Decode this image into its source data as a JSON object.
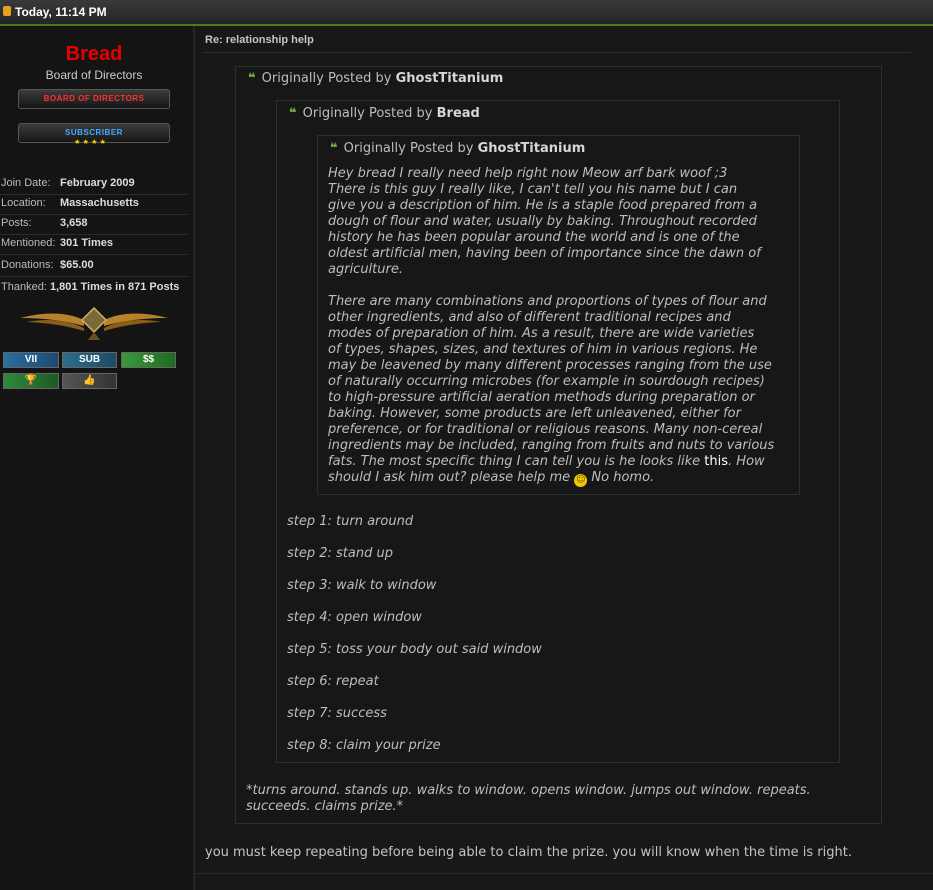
{
  "topbar": {
    "date": "Today, 11:14 PM"
  },
  "user": {
    "name": "Bread",
    "title": "Board of Directors",
    "rank_images": [
      "BOARD OF DIRECTORS",
      "SUBSCRIBER"
    ],
    "info": [
      {
        "label": "Join Date:",
        "value": "February 2009"
      },
      {
        "label": "Location:",
        "value": "Massachusetts"
      },
      {
        "label": "Posts:",
        "value": "3,658"
      },
      {
        "label": "Mentioned:",
        "value": "301 Times"
      },
      {
        "label": "Donations:",
        "value": "$65.00"
      }
    ],
    "thanked_label": "Thanked:",
    "thanked_value": "1,801 Times in 871 Posts",
    "awards": [
      "VII",
      "SUB",
      "$$",
      "🏆",
      "👍"
    ]
  },
  "post": {
    "title": "Re: relationship help",
    "quote1": {
      "prefix": "Originally Posted by",
      "author": "GhostTitanium"
    },
    "quote2": {
      "prefix": "Originally Posted by",
      "author": "Bread"
    },
    "quote3": {
      "prefix": "Originally Posted by",
      "author": "GhostTitanium",
      "para1": "Hey bread I really need help right now Meow arf bark woof ;3\nThere is this guy I really like, I can't tell you his name but I can\ngive you a description of him. He is a staple food prepared from a\ndough of flour and water, usually by baking. Throughout recorded\nhistory he has been popular around the world and is one of the\noldest artificial men, having been of importance since the dawn of\nagriculture.",
      "para2": "There are many combinations and proportions of types of flour and\nother ingredients, and also of different traditional recipes and\nmodes of preparation of him. As a result, there are wide varieties\nof types, shapes, sizes, and textures of him in various regions. He\nmay be leavened by many different processes ranging from the use\nof naturally occurring microbes (for example in sourdough recipes)\nto high-pressure artificial aeration methods during preparation or\nbaking. However, some products are left unleavened, either for\npreference, or for traditional or religious reasons. Many non-cereal\ningredients may be included, ranging from fruits and nuts to various\nfats. The most specific thing I can tell you is he looks like ",
      "link": "this",
      "para2_end": ". How",
      "line_last": "should I ask him out? please help me ",
      "smiley": "☺",
      "line_tail": " No homo."
    },
    "steps": [
      "step 1: turn around",
      "step 2: stand up",
      "step 3: walk to window",
      "step 4: open window",
      "step 5: toss your body out said window",
      "step 6: repeat",
      "step 7: success",
      "step 8: claim your prize"
    ],
    "quote1_text": "*turns around. stands up. walks to window. opens window. jumps out window. repeats.\nsucceeds. claims prize.*",
    "reply": "you must keep repeating before being able to claim the prize. you will know when the time is right."
  },
  "colors": {
    "username": "#e60000",
    "accent": "#4a7a1e",
    "quote_icon": "#7ab83a"
  }
}
